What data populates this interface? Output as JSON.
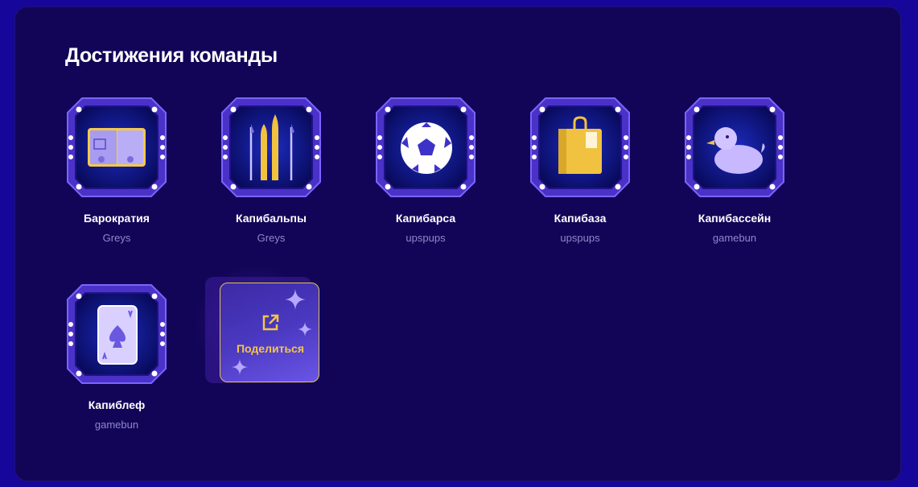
{
  "section_title": "Достижения команды",
  "achievements": [
    {
      "name": "Барократия",
      "author": "Greys",
      "icon": "passport-icon"
    },
    {
      "name": "Капибальпы",
      "author": "Greys",
      "icon": "skis-icon"
    },
    {
      "name": "Капибарса",
      "author": "upspups",
      "icon": "soccer-ball-icon"
    },
    {
      "name": "Капибаза",
      "author": "upspups",
      "icon": "shopping-bag-icon"
    },
    {
      "name": "Капибассейн",
      "author": "gamebun",
      "icon": "rubber-duck-icon"
    },
    {
      "name": "Капиблеф",
      "author": "gamebun",
      "icon": "ace-of-spades-card-icon"
    }
  ],
  "share": {
    "label": "Поделиться",
    "icon": "share-external-icon"
  },
  "colors": {
    "background": "#16079a",
    "panel": "#120558",
    "badge_frame": "#4a32c8",
    "badge_inner": "#0b0a6e",
    "share_accent": "#f4c544"
  }
}
